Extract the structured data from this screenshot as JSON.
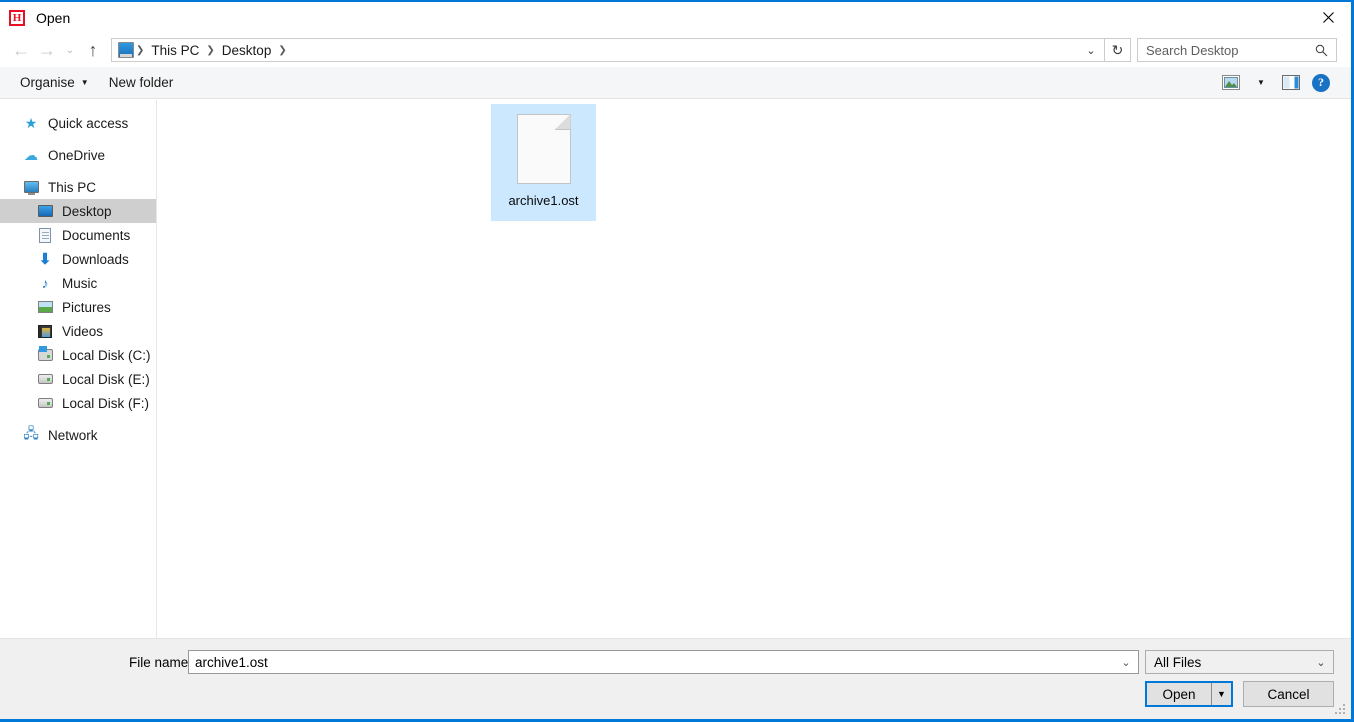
{
  "window": {
    "title": "Open",
    "app_icon": "H",
    "accent_color": "#0078d7",
    "icon_color": "#e81123",
    "close_icon": "close-icon"
  },
  "navbar": {
    "back_icon": "←",
    "forward_icon": "→",
    "history_icon": "⌄",
    "up_icon": "↑",
    "breadcrumb": [
      "This PC",
      "Desktop"
    ],
    "breadcrumb_separator": "❯",
    "address_dropdown_icon": "⌄",
    "refresh_icon": "↻",
    "search": {
      "placeholder": "Search Desktop",
      "value": "",
      "icon": "search-icon"
    }
  },
  "toolbar": {
    "organise_label": "Organise",
    "organise_caret": "▼",
    "new_folder_label": "New folder",
    "view_icon": "view-options-icon",
    "view_caret": "▼",
    "preview_pane_icon": "preview-pane-icon",
    "help_label": "?"
  },
  "sidebar": {
    "items": [
      {
        "label": "Quick access",
        "icon": "star-icon",
        "level": 0,
        "selected": false
      },
      {
        "label": "OneDrive",
        "icon": "cloud-icon",
        "level": 0,
        "selected": false
      },
      {
        "label": "This PC",
        "icon": "monitor-icon",
        "level": 0,
        "selected": false
      },
      {
        "label": "Desktop",
        "icon": "desktop-icon",
        "level": 1,
        "selected": true
      },
      {
        "label": "Documents",
        "icon": "documents-icon",
        "level": 1,
        "selected": false
      },
      {
        "label": "Downloads",
        "icon": "downloads-icon",
        "level": 1,
        "selected": false
      },
      {
        "label": "Music",
        "icon": "music-icon",
        "level": 1,
        "selected": false
      },
      {
        "label": "Pictures",
        "icon": "pictures-icon",
        "level": 1,
        "selected": false
      },
      {
        "label": "Videos",
        "icon": "videos-icon",
        "level": 1,
        "selected": false
      },
      {
        "label": "Local Disk (C:)",
        "icon": "disk-system-icon",
        "level": 1,
        "selected": false
      },
      {
        "label": "Local Disk (E:)",
        "icon": "disk-icon",
        "level": 1,
        "selected": false
      },
      {
        "label": "Local Disk (F:)",
        "icon": "disk-icon",
        "level": 1,
        "selected": false
      },
      {
        "label": "Network",
        "icon": "network-icon",
        "level": 0,
        "selected": false
      }
    ]
  },
  "filelist": {
    "files": [
      {
        "name": "archive1.ost",
        "icon": "generic-file-icon",
        "selected": true
      }
    ]
  },
  "bottom": {
    "filename_label": "File name:",
    "filename_value": "archive1.ost",
    "filename_caret": "⌄",
    "filetype_value": "All Files",
    "filetype_caret": "⌄",
    "open_label": "Open",
    "open_caret": "▼",
    "cancel_label": "Cancel"
  }
}
